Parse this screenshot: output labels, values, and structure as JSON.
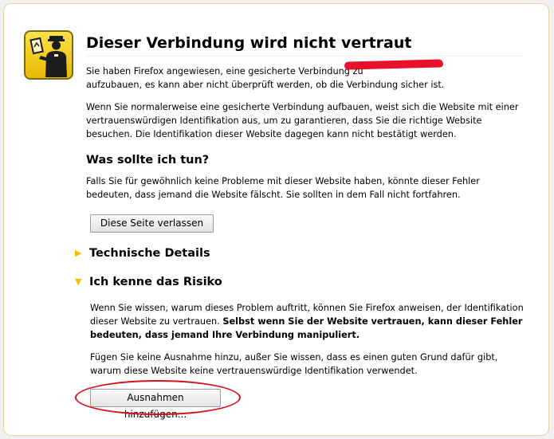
{
  "heading": "Dieser Verbindung wird nicht vertraut",
  "intro": {
    "text_before": "Sie haben Firefox angewiesen, eine gesicherte Verbindung zu ",
    "text_after": " aufzubauen, es kann aber nicht überprüft werden, ob die Verbindung sicher ist."
  },
  "explanation": "Wenn Sie normalerweise eine gesicherte Verbindung aufbauen, weist sich die Website mit einer vertrauenswürdigen Identifikation aus, um zu garantieren, dass Sie die richtige Website besuchen. Die Identifikation dieser Website dagegen kann nicht bestätigt werden.",
  "what_to_do": {
    "heading": "Was sollte ich tun?",
    "text": "Falls Sie für gewöhnlich keine Probleme mit dieser Website haben, könnte dieser Fehler bedeuten, dass jemand die Website fälscht. Sie sollten in dem Fall nicht fortfahren.",
    "leave_button": "Diese Seite verlassen"
  },
  "technical_details": {
    "label": "Technische Details",
    "expanded": false
  },
  "understand_risks": {
    "label": "Ich kenne das Risiko",
    "expanded": true,
    "text_plain": "Wenn Sie wissen, warum dieses Problem auftritt, können Sie Firefox anweisen, der Identifikation dieser Website zu vertrauen. ",
    "text_bold": "Selbst wenn Sie der Website vertrauen, kann dieser Fehler bedeuten, dass jemand Ihre Verbindung manipuliert.",
    "text2": "Fügen Sie keine Ausnahme hinzu, außer Sie wissen, dass es einen guten Grund dafür gibt, warum diese Website keine vertrauenswürdige Identifikation verwendet.",
    "add_exception_button": "Ausnahmen hinzufügen..."
  },
  "icon": "untrusted-connection-officer-icon",
  "colors": {
    "frame_border": "#e4d3a0",
    "triangle": "#f0c000",
    "annotation": "#d8101c",
    "icon_yellow": "#f5d31a"
  }
}
